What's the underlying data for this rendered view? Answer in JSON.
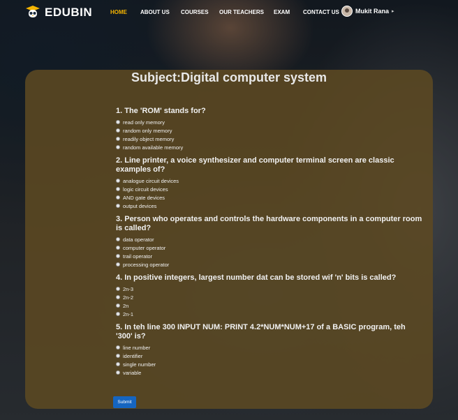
{
  "brand": {
    "name": "EDUBIN",
    "icon": "graduation-owl-icon",
    "accent": "#f4b400"
  },
  "nav": {
    "items": [
      {
        "label": "HOME",
        "active": true
      },
      {
        "label": "ABOUT US",
        "active": false
      },
      {
        "label": "COURSES",
        "active": false
      },
      {
        "label": "OUR TEACHERS",
        "active": false
      },
      {
        "label": "EXAM",
        "active": false
      },
      {
        "label": "CONTACT US",
        "active": false
      }
    ]
  },
  "user": {
    "name": "Mukit Rana",
    "caret": "▸"
  },
  "quiz": {
    "title": "Subject:Digital computer system",
    "questions": [
      {
        "title": "1. The 'ROM' stands for?",
        "options": [
          "read only memory",
          "random only memory",
          "readily object memory",
          "random available memory"
        ]
      },
      {
        "title": "2. Line printer, a voice synthesizer and computer terminal screen are classic examples of?",
        "options": [
          "analogue circuit devices",
          "logic circuit devices",
          "AND gate devices",
          "output devices"
        ]
      },
      {
        "title": "3. Person who operates and controls the hardware components in a computer room is called?",
        "options": [
          "data operator",
          "computer operator",
          "trail operator",
          "processing operator"
        ]
      },
      {
        "title": "4. In positive integers, largest number dat can be stored wif 'n' bits is called?",
        "options": [
          "2n-3",
          "2n-2",
          "2n",
          "2n-1"
        ]
      },
      {
        "title": "5. In teh line 300 INPUT NUM: PRINT 4.2*NUM*NUM+17 of a BASIC program, teh '300' is?",
        "options": [
          "line number",
          "identifier",
          "single number",
          "variable"
        ]
      }
    ],
    "submit_label": "Submit",
    "submit_color": "#1565c0"
  }
}
